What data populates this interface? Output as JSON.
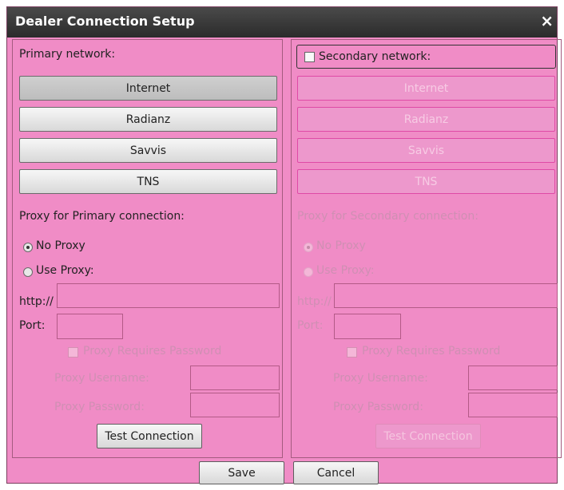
{
  "window": {
    "title": "Dealer Connection Setup",
    "close_label": "×"
  },
  "primary": {
    "heading": "Primary network:",
    "networks": [
      "Internet",
      "Radianz",
      "Savvis",
      "TNS"
    ],
    "selected": "Internet",
    "proxy_heading": "Proxy for Primary connection:",
    "no_proxy": "No Proxy",
    "use_proxy": "Use Proxy:",
    "http_label": "http://",
    "http_value": "",
    "port_label": "Port:",
    "port_value": "",
    "requires_password": "Proxy Requires Password",
    "username_label": "Proxy Username:",
    "password_label": "Proxy Password:",
    "test_button": "Test Connection"
  },
  "secondary": {
    "heading": "Secondary network:",
    "checked": false,
    "networks": [
      "Internet",
      "Radianz",
      "Savvis",
      "TNS"
    ],
    "proxy_heading": "Proxy for Secondary connection:",
    "no_proxy": "No Proxy",
    "use_proxy": "Use Proxy:",
    "http_label": "http://",
    "http_value": "",
    "port_label": "Port:",
    "port_value": "",
    "requires_password": "Proxy Requires Password",
    "username_label": "Proxy Username:",
    "password_label": "Proxy Password:",
    "test_button": "Test Connection"
  },
  "footer": {
    "save": "Save",
    "cancel": "Cancel"
  },
  "colors": {
    "background": "#f08cc6",
    "titlebar": "#333333",
    "disabled_text": "#cf8fb3"
  }
}
